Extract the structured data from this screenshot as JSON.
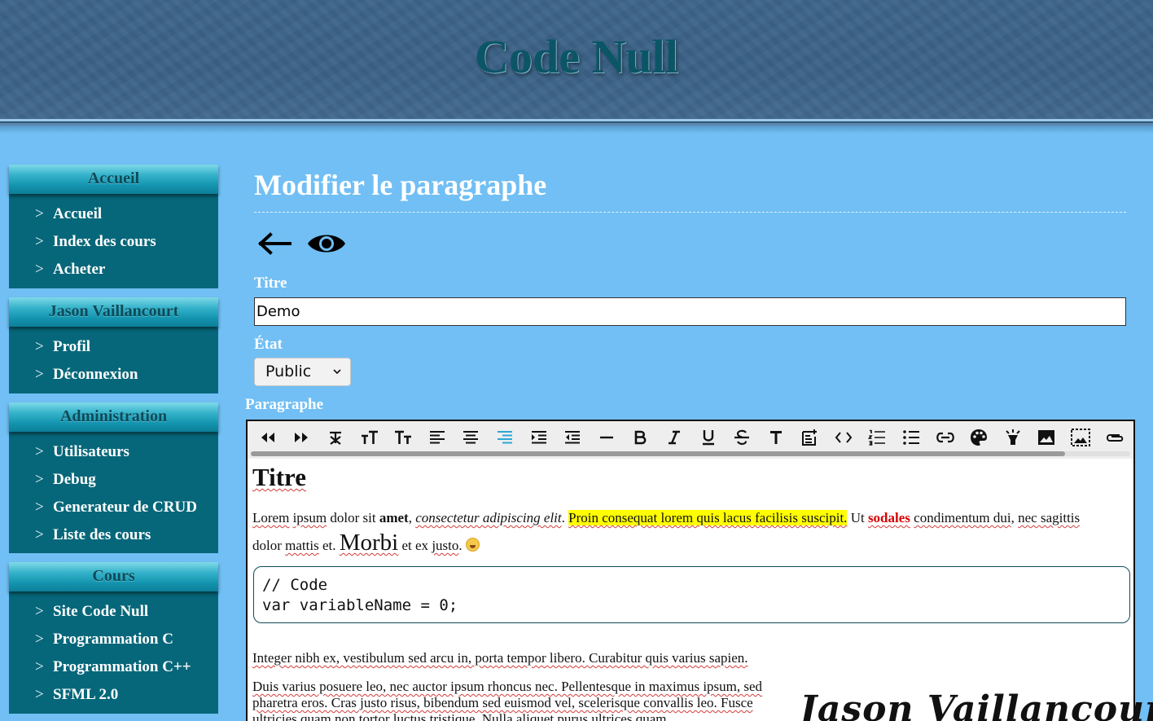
{
  "site": {
    "title": "Code Null"
  },
  "sidebar": {
    "sections": [
      {
        "heading": "Accueil",
        "items": [
          {
            "label": "Accueil"
          },
          {
            "label": "Index des cours"
          },
          {
            "label": "Acheter"
          }
        ]
      },
      {
        "heading": "Jason Vaillancourt",
        "items": [
          {
            "label": "Profil"
          },
          {
            "label": "Déconnexion"
          }
        ]
      },
      {
        "heading": "Administration",
        "items": [
          {
            "label": "Utilisateurs"
          },
          {
            "label": "Debug"
          },
          {
            "label": "Generateur de CRUD"
          },
          {
            "label": "Liste des cours"
          }
        ]
      },
      {
        "heading": "Cours",
        "items": [
          {
            "label": "Site Code Null"
          },
          {
            "label": "Programmation C"
          },
          {
            "label": "Programmation C++"
          },
          {
            "label": "SFML 2.0"
          }
        ]
      }
    ],
    "arrow": ">"
  },
  "main": {
    "page_title": "Modifier le paragraphe",
    "icons": [
      "back-arrow-icon",
      "eye-icon"
    ],
    "fields": {
      "title_label": "Titre",
      "title_value": "Demo",
      "state_label": "État",
      "state_value": "Public",
      "paragraph_label": "Paragraphe"
    }
  },
  "editor": {
    "toolbar": [
      "undo-icon",
      "redo-icon",
      "clear-format-icon",
      "font-size-increase-icon",
      "font-size-decrease-icon",
      "align-left-icon",
      "align-center-icon",
      "align-right-icon",
      "indent-icon",
      "outdent-icon",
      "horizontal-rule-icon",
      "bold-icon",
      "italic-icon",
      "underline-icon",
      "strikethrough-icon",
      "text-icon",
      "note-add-icon",
      "code-icon",
      "ordered-list-icon",
      "unordered-list-icon",
      "link-icon",
      "palette-icon",
      "highlight-icon",
      "image-icon",
      "image-frame-icon",
      "attach-icon"
    ],
    "active_tool": "align-right-icon",
    "content": {
      "heading": "Titre",
      "p1": {
        "w1": "Lorem",
        "w2": "ipsum",
        "t1": " dolor sit ",
        "bold": "amet",
        "t2": ", ",
        "italic": "consectetur adipiscing elit",
        "t3": ". ",
        "highlight": "Proin consequat lorem quis lacus facilisis suscipit.",
        "t4": " Ut ",
        "red": "sodales",
        "t5": " ",
        "w3": "condimentum dui",
        "t6": ", ",
        "w4": "nec sagittis",
        "w5": "dolor",
        "t7": " ",
        "w6": "mattis",
        "t8": " et. ",
        "big": "Morbi",
        "t9": " et ex ",
        "w7": "justo",
        "t10": ". "
      },
      "code_line1": "// Code",
      "code_line2": "var variableName = 0;",
      "p2": "Integer nibh ex, vestibulum sed arcu in, porta tempor libero. Curabitur quis varius sapien.",
      "p3": "Duis varius posuere leo, nec auctor ipsum rhoncus nec. Pellentesque in maximus ipsum, sed pharetra eros. Cras justo risus, bibendum sed euismod vel, scelerisque convallis leo. Fusce ultricies quam non tortor luctus tristique. Nulla aliquet purus ultrices quam",
      "signature": "Jason Vaillancourt"
    }
  },
  "colors": {
    "background": "#71bff4",
    "header": "#3d6489",
    "sidebar": "#07677a",
    "accent_active": "#2aa8d8",
    "highlight": "#ffff00",
    "red_text": "#d60000"
  }
}
